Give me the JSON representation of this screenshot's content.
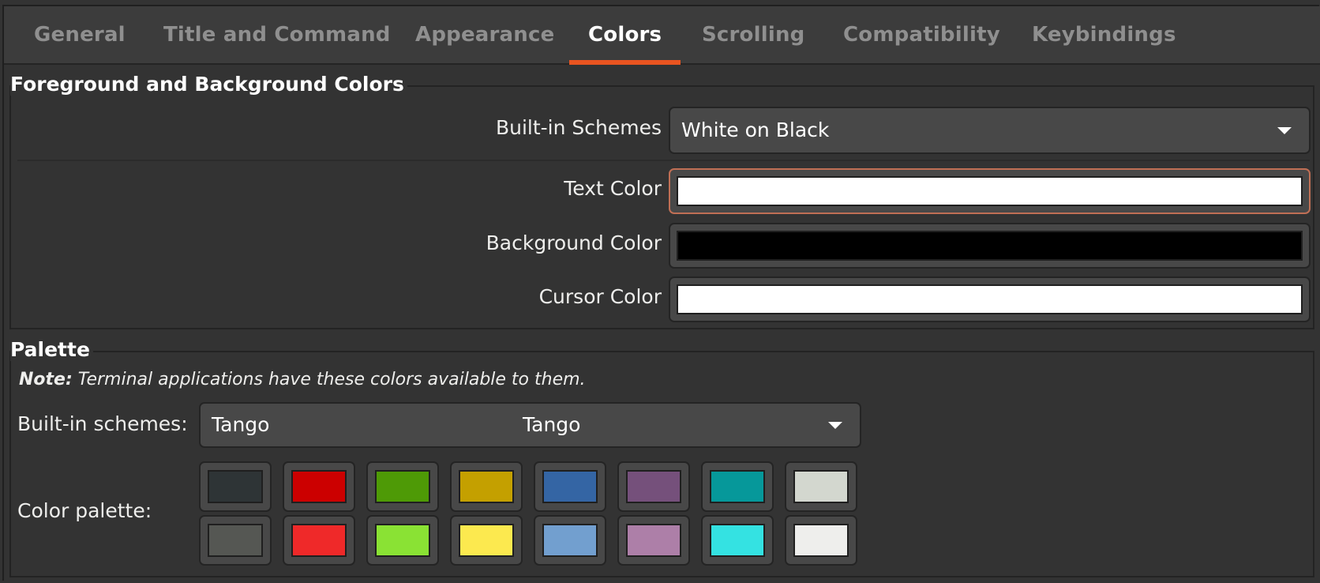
{
  "tabs": [
    {
      "label": "General",
      "active": false
    },
    {
      "label": "Title and Command",
      "active": false
    },
    {
      "label": "Appearance",
      "active": false
    },
    {
      "label": "Colors",
      "active": true
    },
    {
      "label": "Scrolling",
      "active": false
    },
    {
      "label": "Compatibility",
      "active": false
    },
    {
      "label": "Keybindings",
      "active": false
    }
  ],
  "accent_color": "#e95420",
  "fg_bg": {
    "title": "Foreground and Background Colors",
    "builtin_label": "Built-in Schemes",
    "builtin_value": "White on Black",
    "text_color_label": "Text Color",
    "text_color": "#ffffff",
    "background_color_label": "Background Color",
    "background_color": "#000000",
    "cursor_color_label": "Cursor Color",
    "cursor_color": "#ffffff"
  },
  "palette": {
    "title": "Palette",
    "note_bold": "Note:",
    "note_text": " Terminal applications have these colors available to them.",
    "builtin_label": "Built-in schemes:",
    "builtin_value": "Tango",
    "builtin_value_center": "Tango",
    "color_palette_label": "Color palette:",
    "row1": [
      "#2e3436",
      "#cc0000",
      "#4e9a06",
      "#c4a000",
      "#3465a4",
      "#75507b",
      "#06989a",
      "#d3d7cf"
    ],
    "row2": [
      "#555753",
      "#ef2929",
      "#8ae234",
      "#fce94f",
      "#729fcf",
      "#ad7fa8",
      "#34e2e2",
      "#eeeeec"
    ]
  }
}
